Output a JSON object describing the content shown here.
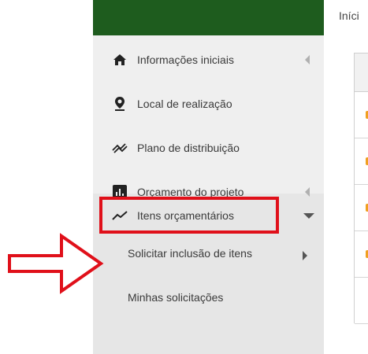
{
  "breadcrumb": "Iníci",
  "sidebar": {
    "items": [
      {
        "label": "Informações iniciais",
        "icon": "home-icon"
      },
      {
        "label": "Local de realização",
        "icon": "map-marker-icon"
      },
      {
        "label": "Plano de distribuição",
        "icon": "distribution-icon"
      },
      {
        "label": "Orçamento do projeto",
        "icon": "bar-chart-icon"
      },
      {
        "label": "Itens orçamentários",
        "icon": "trend-line-icon"
      }
    ],
    "subitems": [
      {
        "label": "Solicitar inclusão de itens"
      },
      {
        "label": "Minhas solicitações"
      }
    ]
  },
  "colors": {
    "header": "#1e5c1e",
    "highlight": "#e0101a",
    "arrow": "#e0101a",
    "row_marker": "#f0a020"
  }
}
